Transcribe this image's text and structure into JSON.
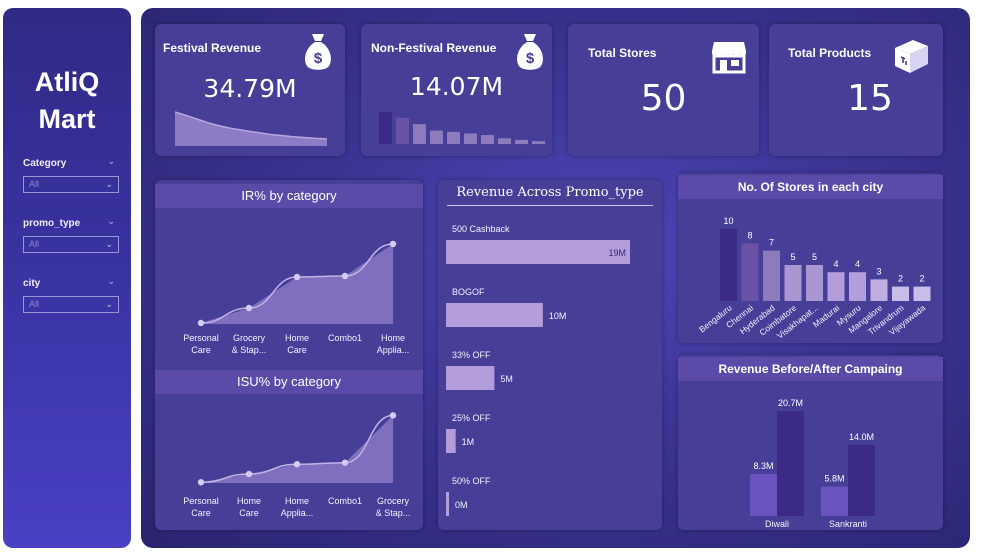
{
  "brand": {
    "line1": "AtliQ",
    "line2": "Mart"
  },
  "filters": [
    {
      "label": "Category",
      "value": "All"
    },
    {
      "label": "promo_type",
      "value": "All"
    },
    {
      "label": "city",
      "value": "All"
    }
  ],
  "kpis": {
    "festival": {
      "title": "Festival Revenue",
      "value": "34.79M",
      "icon": "money-bag-icon"
    },
    "non_festival": {
      "title": "Non-Festival Revenue",
      "value": "14.07M",
      "icon": "money-bag-icon"
    },
    "stores": {
      "title": "Total Stores",
      "value": "50",
      "icon": "store-icon"
    },
    "products": {
      "title": "Total Products",
      "value": "15",
      "icon": "box-icon"
    }
  },
  "colors": {
    "accent": "#5b4aa8",
    "card": "#463e97",
    "line": "#b9a6df",
    "bar_light": "#b39ddb",
    "bar_dark": "#3b2a86"
  },
  "chart_data": [
    {
      "id": "festival_spark",
      "type": "area",
      "values": [
        100,
        88,
        75,
        62,
        52,
        44,
        38,
        32,
        26,
        22,
        18,
        15,
        12,
        10
      ]
    },
    {
      "id": "nonfestival_spark",
      "type": "bar",
      "values": [
        100,
        82,
        62,
        42,
        38,
        33,
        28,
        18,
        13,
        9
      ]
    },
    {
      "id": "ir_by_category",
      "type": "area",
      "title": "IR% by category",
      "categories": [
        [
          "Personal",
          "Care"
        ],
        [
          "Grocery",
          "& Stap..."
        ],
        [
          "Home",
          "Care"
        ],
        [
          "Combo1",
          ""
        ],
        [
          "Home",
          "Applia..."
        ]
      ],
      "values": [
        1,
        16,
        47,
        48,
        80
      ]
    },
    {
      "id": "isu_by_category",
      "type": "area",
      "title": "ISU% by category",
      "categories": [
        [
          "Personal",
          "Care"
        ],
        [
          "Home",
          "Care"
        ],
        [
          "Home",
          "Applia..."
        ],
        [
          "Combo1",
          ""
        ],
        [
          "Grocery",
          "& Stap..."
        ]
      ],
      "values": [
        1,
        12,
        25,
        27,
        90
      ]
    },
    {
      "id": "revenue_promo",
      "type": "bar",
      "title": "Revenue Across Promo_type",
      "categories": [
        "500 Cashback",
        "BOGOF",
        "33% OFF",
        "25% OFF",
        "50% OFF"
      ],
      "values": [
        19,
        10,
        5,
        1,
        0.1
      ],
      "labels": [
        "19M",
        "10M",
        "5M",
        "1M",
        "0M"
      ]
    },
    {
      "id": "stores_city",
      "type": "bar",
      "title": "No. Of Stores in each city",
      "categories": [
        "Bengaluru",
        "Chennai",
        "Hyderabad",
        "Coimbatore",
        "Visakhapat...",
        "Madurai",
        "Mysuru",
        "Mangalore",
        "Trivandrum",
        "Vijayawada"
      ],
      "values": [
        10,
        8,
        7,
        5,
        5,
        4,
        4,
        3,
        2,
        2
      ]
    },
    {
      "id": "before_after",
      "type": "bar",
      "title": "Revenue Before/After Campaing",
      "categories": [
        "Diwali",
        "Sankranti"
      ],
      "series": [
        {
          "values": [
            8.3,
            5.8
          ],
          "labels": [
            "8.3M",
            "5.8M"
          ]
        },
        {
          "values": [
            20.7,
            14.0
          ],
          "labels": [
            "20.7M",
            "14.0M"
          ]
        }
      ]
    }
  ]
}
